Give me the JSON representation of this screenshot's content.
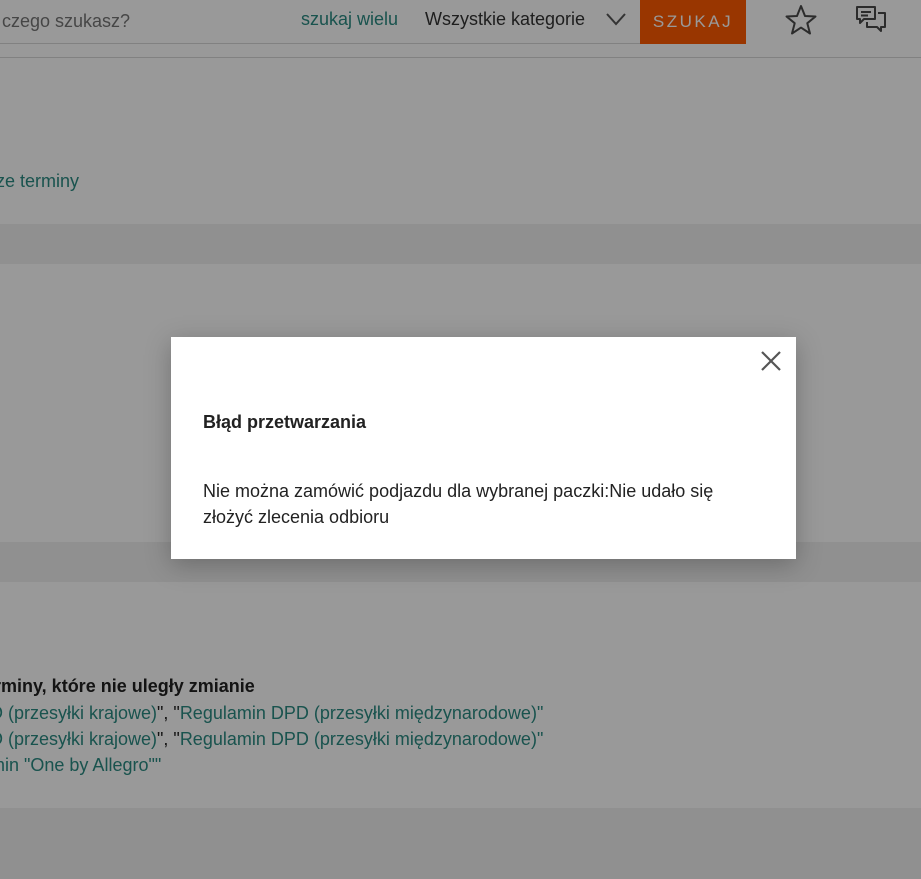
{
  "header": {
    "search_placeholder": "czego szukasz?",
    "search_many": "szukaj wielu",
    "category": "Wszystkie kategorie",
    "search_button": "SZUKAJ"
  },
  "content": {
    "link_terms_top": "ze terminy",
    "terms_heading": "rminy, które nie uległy zmianie",
    "line1_prefix": "D (przesyłki krajowe)",
    "line1_mid": "\", \"",
    "line1_suffix": "Regulamin DPD (przesyłki międzynarodowe)\"",
    "line2_prefix": "D (przesyłki krajowe)",
    "line2_mid": "\", \"",
    "line2_suffix": "Regulamin DPD (przesyłki międzynarodowe)\"",
    "line3_text": "min \"One by Allegro\"\""
  },
  "modal": {
    "title": "Błąd przetwarzania",
    "message": "Nie można zamówić podjazdu dla wybranej paczki:Nie udało się złożyć zlecenia odbioru"
  },
  "colors": {
    "accent": "#ff5a00",
    "link": "#2a8a82",
    "overlay": "rgba(0,0,0,0.4)"
  },
  "icons": [
    "chevron-down-icon",
    "star-icon",
    "chat-icon",
    "close-icon"
  ]
}
